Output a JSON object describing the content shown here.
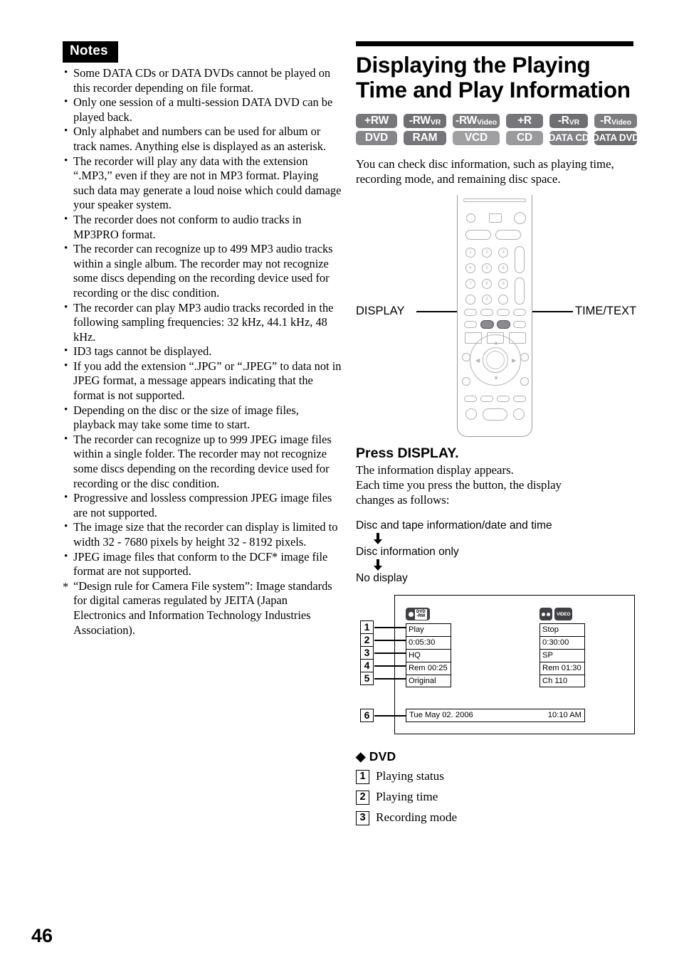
{
  "page": {
    "number": "46"
  },
  "notes": {
    "header": "Notes",
    "items": [
      "Some DATA CDs or DATA DVDs cannot be played on this recorder depending on file format.",
      "Only one session of a multi-session DATA DVD can be played back.",
      "Only alphabet and numbers can be used for album or track names. Anything else is displayed as an asterisk.",
      "The recorder will play any data with the extension “.MP3,” even if they are not in MP3 format. Playing such data may generate a loud noise which could damage your speaker system.",
      "The recorder does not conform to audio tracks in MP3PRO format.",
      "The recorder can recognize up to 499 MP3 audio tracks within a single album. The recorder may not recognize some discs depending on the recording device used for recording or the disc condition.",
      "The recorder can play MP3 audio tracks recorded in the following sampling frequencies: 32 kHz, 44.1 kHz, 48 kHz.",
      "ID3 tags cannot be displayed.",
      "If you add the extension “.JPG” or “.JPEG” to data not in JPEG format, a message appears indicating that the format is not supported.",
      "Depending on the disc or the size of image files, playback may take some time to start.",
      "The recorder can recognize up to 999 JPEG image files within a single folder. The recorder may not recognize some discs depending on the recording device used for recording or the disc condition.",
      "Progressive and lossless compression JPEG image files are not supported.",
      "The image size that the recorder can display is limited to width 32 - 7680 pixels by height 32 - 8192 pixels.",
      "JPEG image files that conform to the DCF* image file format are not supported."
    ],
    "footnote_marker": "*",
    "footnote": "“Design rule for Camera File system”: Image standards for digital cameras regulated by JEITA (Japan Electronics and Information Technology Industries Association)."
  },
  "section": {
    "title": "Displaying the Playing Time and Play Information",
    "intro": "You can check disc information, such as playing time, recording mode, and remaining disc space.",
    "badges_row1": [
      {
        "main": "+RW",
        "sub": ""
      },
      {
        "main": "-RW",
        "sub": "VR"
      },
      {
        "main": "-RW",
        "sub": "Video"
      },
      {
        "main": "+R",
        "sub": ""
      },
      {
        "main": "-R",
        "sub": "VR"
      },
      {
        "main": "-R",
        "sub": "Video"
      }
    ],
    "badges_row2": [
      {
        "main": "DVD",
        "sub": ""
      },
      {
        "main": "RAM",
        "sub": ""
      },
      {
        "main": "VCD",
        "sub": ""
      },
      {
        "main": "CD",
        "sub": ""
      },
      {
        "main": "DATA CD",
        "sub": ""
      },
      {
        "main": "DATA DVD",
        "sub": ""
      }
    ]
  },
  "remote": {
    "callout_left": "DISPLAY",
    "callout_right": "TIME/TEXT",
    "keypad": [
      "1",
      "2",
      "3",
      "4",
      "5",
      "6",
      "7",
      "8",
      "9",
      "0"
    ]
  },
  "step": {
    "heading": "Press DISPLAY.",
    "body_line1": "The information display appears.",
    "body_line2": "Each time you press the button, the display",
    "body_line3": "changes as follows:"
  },
  "sequence": {
    "steps": [
      "Disc and tape information/date and time",
      "Disc information only",
      "No display"
    ]
  },
  "osd": {
    "left_badge": {
      "icon": "record-dot-icon",
      "label_top": "DVD",
      "label_bottom": "-RW"
    },
    "right_badge": {
      "icon": "cassette-reels-icon",
      "label": "VIDEO"
    },
    "left_cells": [
      "Play",
      "0:05:30",
      "HQ",
      "Rem 00:25",
      "Original"
    ],
    "right_cells": [
      "Stop",
      "0:30:00",
      "SP",
      "Rem 01:30",
      "Ch 110"
    ],
    "callout_numbers": [
      "1",
      "2",
      "3",
      "4",
      "5",
      "6"
    ],
    "status_bar_date": "Tue May 02. 2006",
    "status_bar_time": "10:10 AM"
  },
  "legend": {
    "title": "DVD",
    "diamond": "◆",
    "items": [
      {
        "num": "1",
        "label": "Playing status"
      },
      {
        "num": "2",
        "label": "Playing time"
      },
      {
        "num": "3",
        "label": "Recording mode"
      }
    ]
  }
}
